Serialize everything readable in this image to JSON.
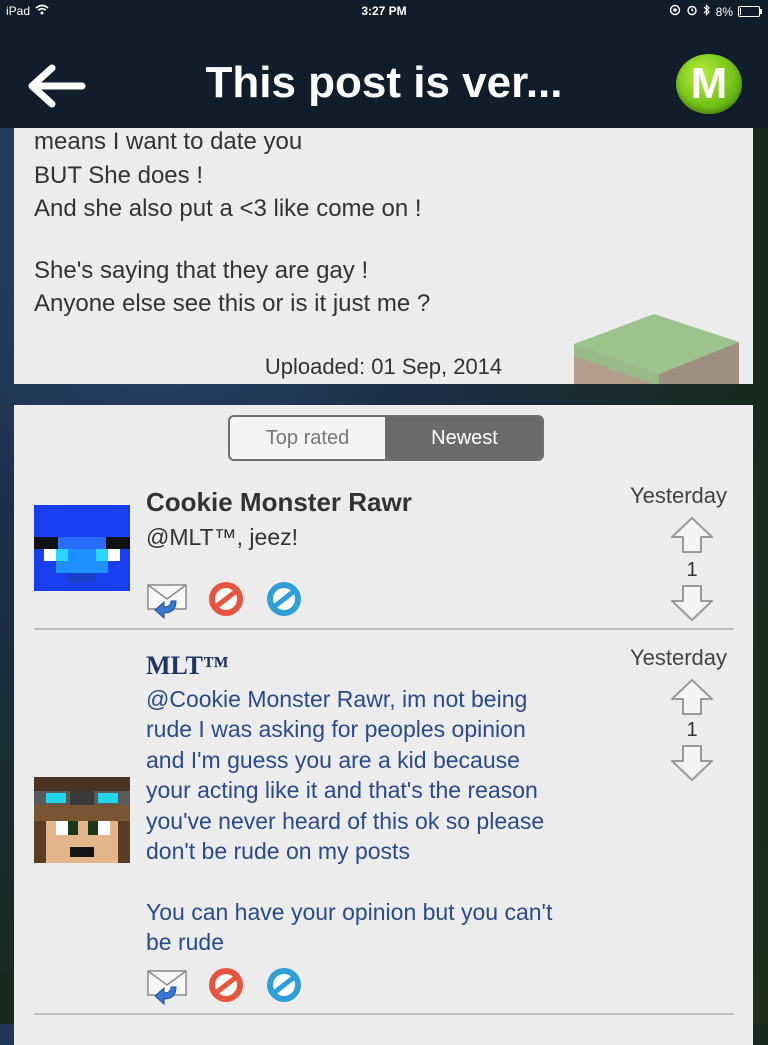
{
  "status_bar": {
    "device": "iPad",
    "time": "3:27 PM",
    "battery": "8%",
    "battery_level": 0.08
  },
  "nav": {
    "title": "This post is ver...",
    "logo_letter": "M",
    "back_icon": "back-arrow-icon"
  },
  "post": {
    "lines": [
      "means I want to date you",
      "BUT She does !",
      "And she also put a <3 like come on !",
      "She's saying that they are gay !",
      "Anyone else see this or is it just me ?"
    ],
    "uploaded": "Uploaded: 01 Sep, 2014"
  },
  "sort_tabs": {
    "top_rated": "Top rated",
    "newest": "Newest",
    "selected": "Newest"
  },
  "comments": [
    {
      "author": "Cookie Monster Rawr",
      "lines": [
        "@MLT™, jeez!"
      ],
      "time": "Yesterday",
      "votes": "1"
    },
    {
      "author": "MLT™",
      "lines": [
        "@Cookie Monster Rawr, im not being",
        "rude I was asking for peoples opinion",
        "and I'm guess you are a kid because",
        "your acting like it and that's the reason",
        "you've never heard of this ok so please",
        "don't be rude on my posts",
        "",
        "You can have your opinion but you can't",
        "be rude"
      ],
      "time": "Yesterday",
      "votes": "1"
    }
  ],
  "colors": {
    "navbar": "#121d2b",
    "panel": "#ececed",
    "logo_green": "#6fbe16",
    "reply_author_blue": "#1f3566",
    "reply_text_blue": "#2b4a8c"
  }
}
